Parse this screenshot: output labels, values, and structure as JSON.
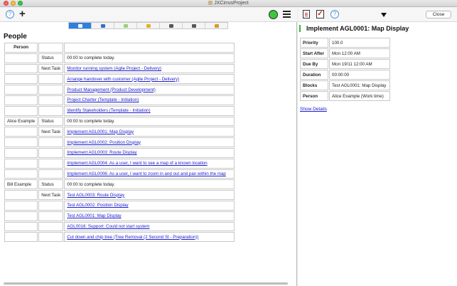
{
  "window": {
    "title": "JXCirrusProject"
  },
  "left_toolbar": {
    "help_glyph": "?",
    "add_glyph": "+"
  },
  "view_tabs": [
    {
      "icon": "people-icon",
      "color": "#ffffff",
      "active": true
    },
    {
      "icon": "person-icon",
      "color": "#2e6fd0",
      "active": false
    },
    {
      "icon": "flag-icon",
      "color": "#9ad07a",
      "active": false
    },
    {
      "icon": "pie-chart-icon",
      "color": "#e8b020",
      "active": false
    },
    {
      "icon": "calendar-icon",
      "color": "#555555",
      "active": false
    },
    {
      "icon": "calendar-month-icon",
      "color": "#555555",
      "active": false
    },
    {
      "icon": "note-icon",
      "color": "#d0a020",
      "active": false
    }
  ],
  "people": {
    "title": "People",
    "header": "Person",
    "rows": [
      {
        "person": "",
        "field": "Status",
        "value": "00:00 to complete today.",
        "link": false
      },
      {
        "person": "",
        "field": "Next Task",
        "value": "Monitor running system (Agile Project - Delivery)",
        "link": true
      },
      {
        "person": "",
        "field": "",
        "value": "Arrange handover with customer (Agile Project - Delivery)",
        "link": true
      },
      {
        "person": "",
        "field": "",
        "value": "Product Management (Product Development)",
        "link": true
      },
      {
        "person": "",
        "field": "",
        "value": "Project Charter (Template - Initiation)",
        "link": true
      },
      {
        "person": "",
        "field": "",
        "value": "Identify Stakeholders (Template - Initiation)",
        "link": true
      },
      {
        "person": "Alice Example",
        "field": "Status",
        "value": "00:00 to complete today.",
        "link": false
      },
      {
        "person": "",
        "field": "Next Task",
        "value": "Implement AGL0001: Map Display",
        "link": true
      },
      {
        "person": "",
        "field": "",
        "value": "Implement AGL0002: Position Display",
        "link": true
      },
      {
        "person": "",
        "field": "",
        "value": "Implement AGL0003: Route Display",
        "link": true
      },
      {
        "person": "",
        "field": "",
        "value": "Implement AGL0004: As a user, I want to see a map of a known location",
        "link": true
      },
      {
        "person": "",
        "field": "",
        "value": "Implement AGL0006: As a user, I want to zoom in and out and pan within the map",
        "link": true
      },
      {
        "person": "Bill Example",
        "field": "Status",
        "value": "00:00 to complete today.",
        "link": false
      },
      {
        "person": "",
        "field": "Next Task",
        "value": "Test AGL0003: Route Display",
        "link": true
      },
      {
        "person": "",
        "field": "",
        "value": "Test AGL0002: Position Display",
        "link": true
      },
      {
        "person": "",
        "field": "",
        "value": "Test AGL0001: Map Display",
        "link": true
      },
      {
        "person": "",
        "field": "",
        "value": "AGL0016: Support: Could not start system",
        "link": true
      },
      {
        "person": "",
        "field": "",
        "value": "Cut down and chip tree (Tree Removal (2 Second St - Preparation))",
        "link": true
      }
    ]
  },
  "right_toolbar": {
    "help_glyph": "?",
    "close_label": "Close"
  },
  "task": {
    "title": "Implement AGL0001: Map Display",
    "details": [
      {
        "label": "Priority",
        "value": "100.0"
      },
      {
        "label": "Start After",
        "value": "Mon 12:00 AM"
      },
      {
        "label": "Due By",
        "value": "Mon 19/11 12:00 AM"
      },
      {
        "label": "Duration",
        "value": "00:00:00"
      },
      {
        "label": "Blocks",
        "value": "Test AGL0001: Map Display"
      },
      {
        "label": "Person",
        "value": "Alice Example (Work time)"
      }
    ],
    "show_details_label": "Show Details"
  },
  "colors": {
    "accent": "#2e7fe0",
    "link": "#1a1acc",
    "status_green": "#3cc83c",
    "close_red": "#fc605c"
  }
}
